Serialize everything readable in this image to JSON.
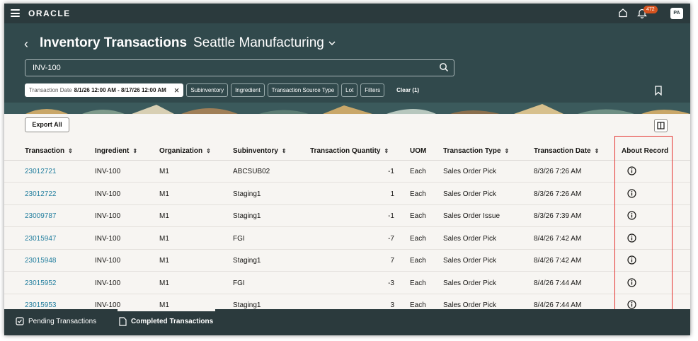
{
  "topbar": {
    "logo": "ORACLE",
    "notification_count": "472",
    "avatar_initials": "PA"
  },
  "header": {
    "title": "Inventory Transactions",
    "organization": "Seattle Manufacturing",
    "search_value": "INV-100",
    "filters": {
      "active_label": "Transaction Date",
      "active_value": "8/1/26 12:00 AM - 8/17/26 12:00 AM",
      "chips": [
        "Subinventory",
        "Ingredient",
        "Transaction Source Type",
        "Lot",
        "Filters"
      ],
      "clear_label": "Clear (1)"
    }
  },
  "toolbar": {
    "export_label": "Export All"
  },
  "table": {
    "columns": [
      "Transaction",
      "Ingredient",
      "Organization",
      "Subinventory",
      "Transaction Quantity",
      "UOM",
      "Transaction Type",
      "Transaction Date",
      "About Record"
    ],
    "rows": [
      {
        "transaction": "23012721",
        "ingredient": "INV-100",
        "org": "M1",
        "subinv": "ABCSUB02",
        "qty": "-1",
        "uom": "Each",
        "type": "Sales Order Pick",
        "date": "8/3/26 7:26 AM"
      },
      {
        "transaction": "23012722",
        "ingredient": "INV-100",
        "org": "M1",
        "subinv": "Staging1",
        "qty": "1",
        "uom": "Each",
        "type": "Sales Order Pick",
        "date": "8/3/26 7:26 AM"
      },
      {
        "transaction": "23009787",
        "ingredient": "INV-100",
        "org": "M1",
        "subinv": "Staging1",
        "qty": "-1",
        "uom": "Each",
        "type": "Sales Order Issue",
        "date": "8/3/26 7:39 AM"
      },
      {
        "transaction": "23015947",
        "ingredient": "INV-100",
        "org": "M1",
        "subinv": "FGI",
        "qty": "-7",
        "uom": "Each",
        "type": "Sales Order Pick",
        "date": "8/4/26 7:42 AM"
      },
      {
        "transaction": "23015948",
        "ingredient": "INV-100",
        "org": "M1",
        "subinv": "Staging1",
        "qty": "7",
        "uom": "Each",
        "type": "Sales Order Pick",
        "date": "8/4/26 7:42 AM"
      },
      {
        "transaction": "23015952",
        "ingredient": "INV-100",
        "org": "M1",
        "subinv": "FGI",
        "qty": "-3",
        "uom": "Each",
        "type": "Sales Order Pick",
        "date": "8/4/26 7:44 AM"
      },
      {
        "transaction": "23015953",
        "ingredient": "INV-100",
        "org": "M1",
        "subinv": "Staging1",
        "qty": "3",
        "uom": "Each",
        "type": "Sales Order Pick",
        "date": "8/4/26 7:44 AM"
      }
    ]
  },
  "footer": {
    "tabs": [
      "Pending Transactions",
      "Completed Transactions"
    ],
    "active_tab": "Completed Transactions"
  },
  "colors": {
    "header_bg": "#31494c",
    "topbar_bg": "#2b3a3d",
    "link": "#227e9e",
    "highlight": "#e5322e",
    "badge": "#d6531f"
  }
}
